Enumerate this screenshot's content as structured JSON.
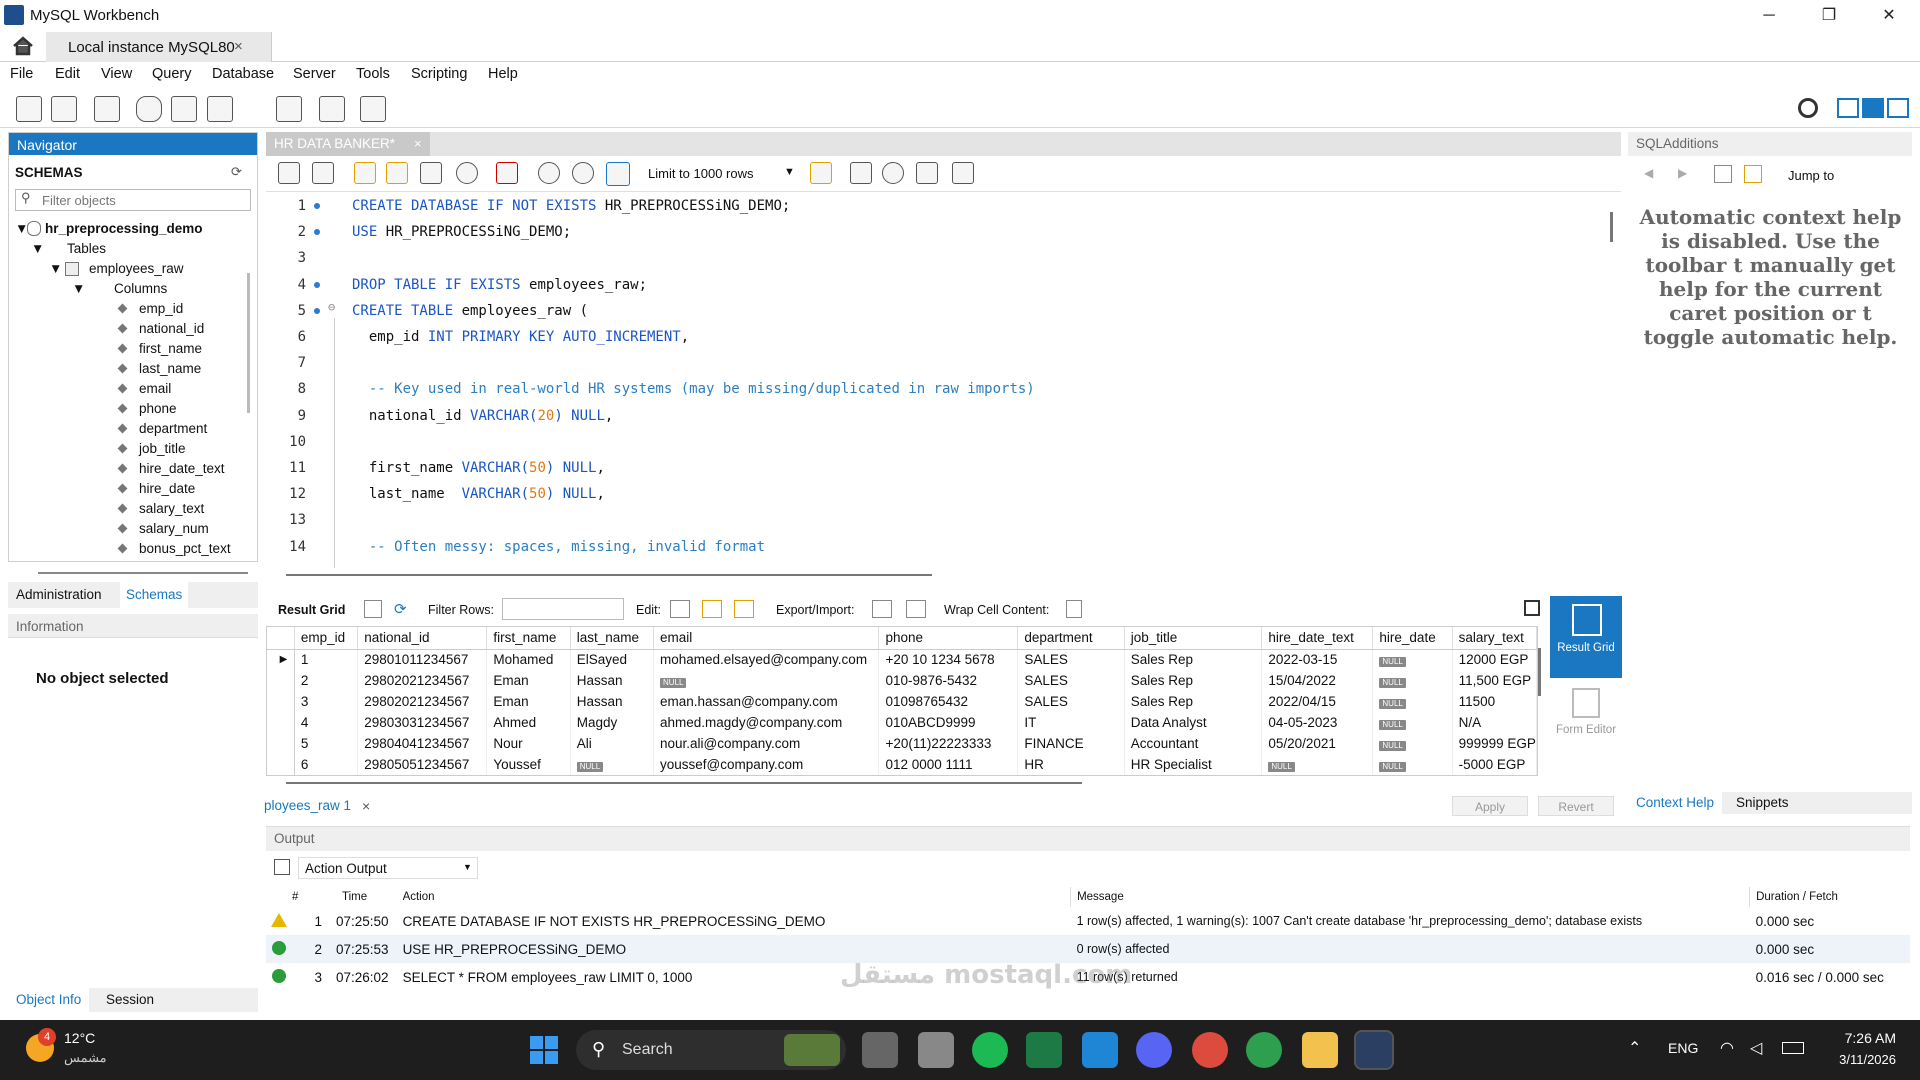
{
  "window": {
    "title": "MySQL Workbench",
    "controls": [
      "─",
      "❐",
      "✕"
    ]
  },
  "connection_tab": {
    "label": "Local instance MySQL80",
    "close": "×"
  },
  "menu": [
    "File",
    "Edit",
    "View",
    "Query",
    "Database",
    "Server",
    "Tools",
    "Scripting",
    "Help"
  ],
  "navigator": {
    "header": "Navigator",
    "schemas_label": "SCHEMAS",
    "filter_placeholder": "Filter objects",
    "schema": "hr_preprocessing_demo",
    "tables_label": "Tables",
    "table": "employees_raw",
    "columns_label": "Columns",
    "columns": [
      "emp_id",
      "national_id",
      "first_name",
      "last_name",
      "email",
      "phone",
      "department",
      "job_title",
      "hire_date_text",
      "hire_date",
      "salary_text",
      "salary_num",
      "bonus_pct_text"
    ]
  },
  "nav_tabs": [
    "Administration",
    "Schemas"
  ],
  "information": {
    "header": "Information",
    "empty_text": "No object selected"
  },
  "bottom_tabs": [
    "Object Info",
    "Session"
  ],
  "editor": {
    "tab_label": "HR DATA BANKER*",
    "limit_label": "Limit to 1000 rows",
    "lines": [
      {
        "n": "1",
        "segs": [
          [
            "kw",
            "CREATE DATABASE IF NOT EXISTS "
          ],
          [
            "",
            "HR_PREPROCESSiNG_DEMO;"
          ]
        ]
      },
      {
        "n": "2",
        "segs": [
          [
            "kw",
            "USE "
          ],
          [
            "",
            "HR_PREPROCESSiNG_DEMO;"
          ]
        ]
      },
      {
        "n": "3",
        "segs": []
      },
      {
        "n": "4",
        "segs": [
          [
            "kw",
            "DROP TABLE IF EXISTS "
          ],
          [
            "",
            "employees_raw;"
          ]
        ]
      },
      {
        "n": "5",
        "segs": [
          [
            "kw",
            "CREATE TABLE "
          ],
          [
            "",
            "employees_raw ("
          ]
        ]
      },
      {
        "n": "6",
        "segs": [
          [
            "",
            "  emp_id "
          ],
          [
            "kw",
            "INT PRIMARY KEY AUTO_INCREMENT"
          ],
          [
            "",
            ","
          ]
        ]
      },
      {
        "n": "7",
        "segs": []
      },
      {
        "n": "8",
        "segs": [
          [
            "cm",
            "  -- Key used in real-world HR systems (may be missing/duplicated in raw imports)"
          ]
        ]
      },
      {
        "n": "9",
        "segs": [
          [
            "",
            "  national_id "
          ],
          [
            "kw",
            "VARCHAR("
          ],
          [
            "num",
            "20"
          ],
          [
            "kw",
            ") NULL"
          ],
          [
            "",
            ","
          ]
        ]
      },
      {
        "n": "10",
        "segs": []
      },
      {
        "n": "11",
        "segs": [
          [
            "",
            "  first_name "
          ],
          [
            "kw",
            "VARCHAR("
          ],
          [
            "num",
            "50"
          ],
          [
            "kw",
            ") NULL"
          ],
          [
            "",
            ","
          ]
        ]
      },
      {
        "n": "12",
        "segs": [
          [
            "",
            "  last_name  "
          ],
          [
            "kw",
            "VARCHAR("
          ],
          [
            "num",
            "50"
          ],
          [
            "kw",
            ") NULL"
          ],
          [
            "",
            ","
          ]
        ]
      },
      {
        "n": "13",
        "segs": []
      },
      {
        "n": "14",
        "segs": [
          [
            "cm",
            "  -- Often messy: spaces, missing, invalid format"
          ]
        ]
      }
    ]
  },
  "result": {
    "label": "Result Grid",
    "filter_label": "Filter Rows:",
    "edit_label": "Edit:",
    "export_label": "Export/Import:",
    "wrap_label": "Wrap Cell Content:",
    "columns": [
      "emp_id",
      "national_id",
      "first_name",
      "last_name",
      "email",
      "phone",
      "department",
      "job_title",
      "hire_date_text",
      "hire_date",
      "salary_text"
    ],
    "rows": [
      [
        "1",
        "29801011234567",
        "Mohamed",
        "ElSayed",
        "mohamed.elsayed@company.com",
        "+20 10 1234 5678",
        "SALES",
        "Sales Rep",
        "2022-03-15",
        "NULL",
        "12000 EGP"
      ],
      [
        "2",
        "29802021234567",
        "Eman",
        "Hassan",
        "NULL",
        "010-9876-5432",
        "SALES",
        "Sales Rep",
        "15/04/2022",
        "NULL",
        "11,500 EGP"
      ],
      [
        "3",
        "29802021234567",
        "Eman",
        "Hassan",
        "eman.hassan@company.com",
        "01098765432",
        "SALES",
        "Sales Rep",
        "2022/04/15",
        "NULL",
        "11500"
      ],
      [
        "4",
        "29803031234567",
        "Ahmed",
        "Magdy",
        "ahmed.magdy@company.com",
        "010ABCD9999",
        "IT",
        "Data Analyst",
        "04-05-2023",
        "NULL",
        "N/A"
      ],
      [
        "5",
        "29804041234567",
        "Nour",
        "Ali",
        "nour.ali@company.com",
        "+20(11)22223333",
        "FINANCE",
        "Accountant",
        "05/20/2021",
        "NULL",
        "999999 EGP"
      ],
      [
        "6",
        "29805051234567",
        "Youssef",
        "NULL",
        "youssef@company.com",
        "012 0000 1111",
        "HR",
        "HR Specialist",
        "NULL",
        "NULL",
        "-5000 EGP"
      ]
    ],
    "side": {
      "grid": "Result Grid",
      "form": "Form Editor"
    },
    "tab_label": "ployees_raw 1",
    "apply": "Apply",
    "revert": "Revert"
  },
  "output": {
    "header": "Output",
    "selector": "Action Output",
    "columns": [
      "#",
      "Time",
      "Action",
      "Message",
      "Duration / Fetch"
    ],
    "rows": [
      {
        "status": "warn",
        "n": "1",
        "time": "07:25:50",
        "action": "CREATE DATABASE IF NOT EXISTS HR_PREPROCESSiNG_DEMO",
        "message": "1 row(s) affected, 1 warning(s): 1007 Can't create database 'hr_preprocessing_demo'; database exists",
        "duration": "0.000 sec"
      },
      {
        "status": "ok",
        "n": "2",
        "time": "07:25:53",
        "action": "USE HR_PREPROCESSiNG_DEMO",
        "message": "0 row(s) affected",
        "duration": "0.000 sec"
      },
      {
        "status": "ok",
        "n": "3",
        "time": "07:26:02",
        "action": "SELECT * FROM employees_raw LIMIT 0, 1000",
        "message": "11 row(s) returned",
        "duration": "0.016 sec / 0.000 sec"
      }
    ]
  },
  "sql_additions": {
    "header": "SQLAdditions",
    "jump_to": "Jump to",
    "help_text": "Automatic context help is disabled. Use the toolbar t manually get help for the current caret position or t toggle automatic help.",
    "tabs": [
      "Context Help",
      "Snippets"
    ]
  },
  "taskbar": {
    "weather_temp": "12°C",
    "weather_desc": "مشمس",
    "weather_badge": "4",
    "search": "Search",
    "lang": "ENG",
    "time": "7:26 AM",
    "date": "3/11/2026"
  },
  "watermark": "مستقل mostaql.com",
  "colors": {
    "accent": "#1a78c2",
    "keyword": "#1b55c4",
    "comment": "#2c7fc0",
    "number": "#e07a12",
    "taskbar": "#1e1e1e"
  }
}
